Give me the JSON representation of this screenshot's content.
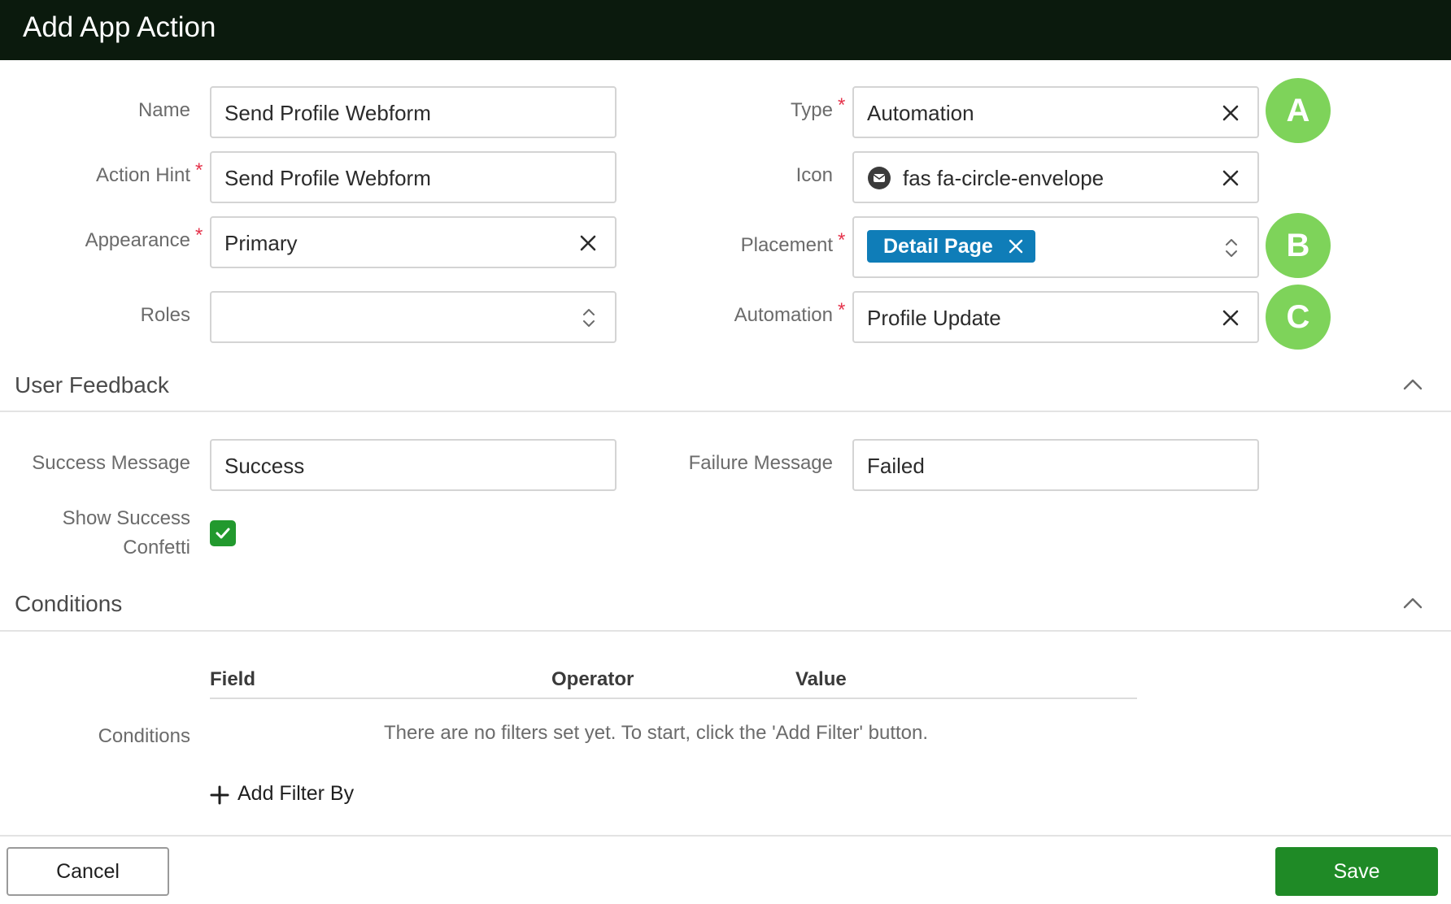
{
  "header": {
    "title": "Add App Action"
  },
  "form": {
    "name": {
      "label": "Name",
      "value": "Send Profile Webform"
    },
    "action_hint": {
      "label": "Action Hint",
      "required_mark": "*",
      "value": "Send Profile Webform"
    },
    "appearance": {
      "label": "Appearance",
      "required_mark": "*",
      "value": "Primary"
    },
    "roles": {
      "label": "Roles",
      "value": ""
    },
    "type": {
      "label": "Type",
      "required_mark": "*",
      "value": "Automation"
    },
    "icon": {
      "label": "Icon",
      "value": "fas fa-circle-envelope",
      "icon_name": "circle-envelope-icon"
    },
    "placement": {
      "label": "Placement",
      "required_mark": "*",
      "chip": "Detail Page"
    },
    "automation": {
      "label": "Automation",
      "required_mark": "*",
      "value": "Profile Update"
    }
  },
  "annotations": [
    "A",
    "B",
    "C"
  ],
  "user_feedback": {
    "title": "User Feedback",
    "success_message": {
      "label": "Success Message",
      "value": "Success"
    },
    "failure_message": {
      "label": "Failure Message",
      "value": "Failed"
    },
    "show_confetti": {
      "label_line1": "Show Success",
      "label_line2": "Confetti",
      "checked": true
    }
  },
  "conditions": {
    "title": "Conditions",
    "label": "Conditions",
    "columns": [
      "Field",
      "Operator",
      "Value"
    ],
    "empty_message": "There are no filters set yet. To start, click the 'Add Filter' button.",
    "add_filter_label": "Add Filter By"
  },
  "footer": {
    "cancel_label": "Cancel",
    "save_label": "Save"
  },
  "colors": {
    "header_bg": "#0b1a0d",
    "chip": "#0f7db8",
    "badge": "#7ed35a",
    "save": "#1f8a26",
    "required": "#e5334b",
    "checkbox": "#22992e"
  }
}
